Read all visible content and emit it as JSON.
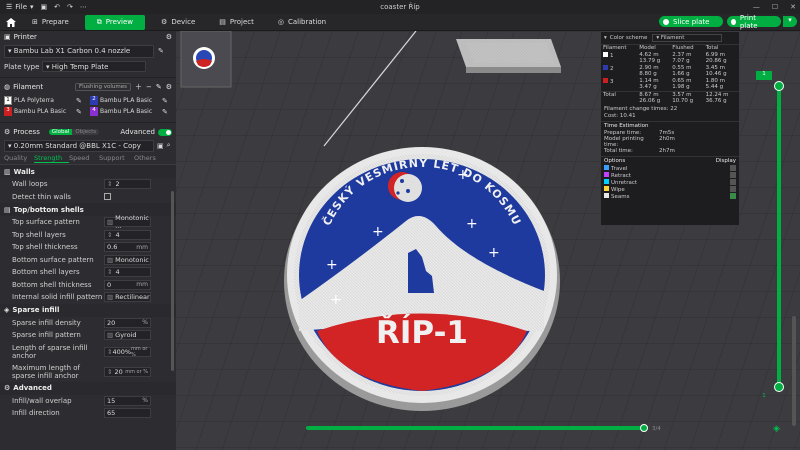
{
  "app": {
    "title": "coaster Říp",
    "file_menu": "File"
  },
  "tabs": [
    {
      "label": "Prepare"
    },
    {
      "label": "Preview"
    },
    {
      "label": "Device"
    },
    {
      "label": "Project"
    },
    {
      "label": "Calibration"
    }
  ],
  "actions": {
    "slice": "Slice plate",
    "print": "Print plate"
  },
  "printer": {
    "section": "Printer",
    "name": "Bambu Lab X1 Carbon 0.4 nozzle",
    "plate_type_label": "Plate type",
    "plate_type": "High Temp Plate"
  },
  "filament": {
    "section": "Filament",
    "flushing": "Flushing volumes",
    "items": [
      {
        "num": "1",
        "name": "PLA Polyterra",
        "color": "#ffffff"
      },
      {
        "num": "2",
        "name": "Bambu PLA Basic",
        "color": "#2e3bb0"
      },
      {
        "num": "3",
        "name": "Bambu PLA Basic",
        "color": "#cc1f1f"
      },
      {
        "num": "4",
        "name": "Bambu PLA Basic",
        "color": "#8a2fd0"
      }
    ]
  },
  "process": {
    "section": "Process",
    "toggle_global": "Global",
    "toggle_objects": "Objects",
    "advanced": "Advanced",
    "profile": "0.20mm Standard @BBL X1C - Copy",
    "subtabs": [
      "Quality",
      "Strength",
      "Speed",
      "Support",
      "Others"
    ],
    "active_subtab": "Strength"
  },
  "params": {
    "walls": {
      "title": "Walls",
      "loops_label": "Wall loops",
      "loops": "2",
      "thin_label": "Detect thin walls"
    },
    "topbottom": {
      "title": "Top/bottom shells",
      "top_pattern_label": "Top surface pattern",
      "top_pattern": "Monotonic ...",
      "top_layers_label": "Top shell layers",
      "top_layers": "4",
      "top_thick_label": "Top shell thickness",
      "top_thick": "0.6",
      "top_thick_unit": "mm",
      "bottom_pattern_label": "Bottom surface pattern",
      "bottom_pattern": "Monotonic",
      "bottom_layers_label": "Bottom shell layers",
      "bottom_layers": "4",
      "bottom_thick_label": "Bottom shell thickness",
      "bottom_thick": "0",
      "bottom_thick_unit": "mm",
      "internal_label": "Internal solid infill pattern",
      "internal": "Rectilinear"
    },
    "sparse": {
      "title": "Sparse infill",
      "density_label": "Sparse infill density",
      "density": "20",
      "density_unit": "%",
      "pattern_label": "Sparse infill pattern",
      "pattern": "Gyroid",
      "anchor_label": "Length of sparse infill anchor",
      "anchor": "400%",
      "anchor_unit": "mm or %",
      "maxanchor_label": "Maximum length of sparse infill anchor",
      "maxanchor": "20",
      "maxanchor_unit": "mm or %"
    },
    "advanced": {
      "title": "Advanced",
      "overlap_label": "Infill/wall overlap",
      "overlap": "15",
      "overlap_unit": "%",
      "direction_label": "Infill direction",
      "direction": "65"
    }
  },
  "model": {
    "line1": "ČESKÝ VESMÍRNÝ LET DO KOSMU",
    "line2": "ŘÍP-1"
  },
  "legend": {
    "scheme_label": "Color scheme",
    "scheme": "Filament",
    "headers": [
      "Filament",
      "Model",
      "Flushed",
      "Total"
    ],
    "rows": [
      {
        "id": "1",
        "color": "#ffffff",
        "model": "4.62 m\n13.79 g",
        "flushed": "2.37 m\n7.07 g",
        "total": "6.99 m\n20.86 g"
      },
      {
        "id": "2",
        "color": "#2e3bb0",
        "model": "2.90 m\n8.80 g",
        "flushed": "0.55 m\n1.66 g",
        "total": "3.45 m\n10.46 g"
      },
      {
        "id": "3",
        "color": "#cc1f1f",
        "model": "1.14 m\n3.47 g",
        "flushed": "0.65 m\n1.98 g",
        "total": "1.80 m\n5.44 g"
      }
    ],
    "total": {
      "label": "Total",
      "model": "8.67 m\n26.06 g",
      "flushed": "3.57 m\n10.70 g",
      "total": "12.24 m\n36.76 g"
    },
    "changes": "Filament change times:  22",
    "cost": "Cost:  10.41",
    "time_title": "Time Estimation",
    "prep": "Prepare time:",
    "prep_val": "7m5s",
    "model_time": "Model printing time:",
    "model_time_val": "2h0m",
    "total_time": "Total time:",
    "total_time_val": "2h7m",
    "options_label": "Options",
    "display_label": "Display",
    "options": [
      {
        "name": "Travel",
        "color": "#3aa0ff"
      },
      {
        "name": "Retract",
        "color": "#c040ff"
      },
      {
        "name": "Unretract",
        "color": "#00d0ff"
      },
      {
        "name": "Wipe",
        "color": "#ffd23a"
      },
      {
        "name": "Seams",
        "color": "#e8e8e8"
      }
    ]
  },
  "layer_slider": {
    "top_label": "1",
    "bottom_label": "1",
    "hslider_label": "3/4"
  }
}
